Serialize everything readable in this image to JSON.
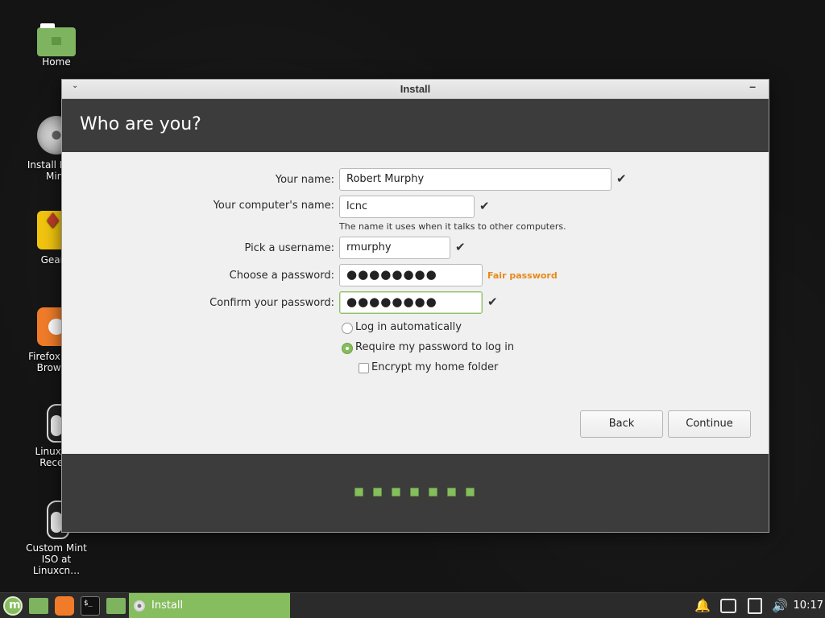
{
  "desktop": {
    "icons": [
      {
        "label": "Home"
      },
      {
        "label": "Install Linux Mint"
      },
      {
        "label": "Geany"
      },
      {
        "label": "Firefox Web Browser"
      },
      {
        "label": "Linuxcnc Recent"
      },
      {
        "label": "Custom Mint ISO at Linuxcn…"
      }
    ]
  },
  "window": {
    "title": "Install",
    "header_title": "Who are you?"
  },
  "form": {
    "name_label": "Your name:",
    "name_value": "Robert Murphy",
    "computer_label": "Your computer's name:",
    "computer_value": "lcnc",
    "computer_hint": "The name it uses when it talks to other computers.",
    "username_label": "Pick a username:",
    "username_value": "rmurphy",
    "password_label": "Choose a password:",
    "password_value": "●●●●●●●●",
    "password_strength": "Fair password",
    "confirm_label": "Confirm your password:",
    "confirm_value": "●●●●●●●●",
    "login_auto_label": "Log in automatically",
    "login_require_label": "Require my password to log in",
    "encrypt_label": "Encrypt my home folder",
    "login_mode": "require-password",
    "encrypt_checked": false
  },
  "buttons": {
    "back": "Back",
    "continue": "Continue"
  },
  "progress": {
    "steps_total": 7,
    "steps_done": 7
  },
  "taskbar": {
    "task_label": "Install",
    "clock": "10:17"
  },
  "colors": {
    "accent": "#86bd5f",
    "strength": "#e78a1b",
    "header": "#3c3c3c"
  }
}
